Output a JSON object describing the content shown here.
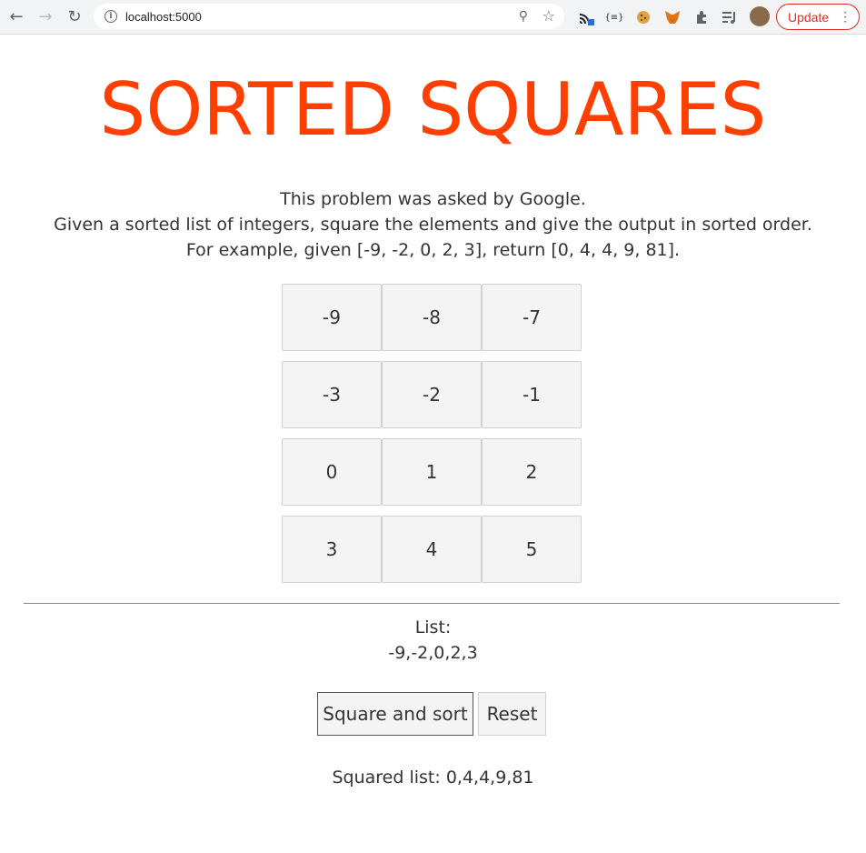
{
  "browser": {
    "url": "localhost:5000",
    "update_label": "Update"
  },
  "title": "SORTED SQUARES",
  "description": {
    "line1": "This problem was asked by Google.",
    "line2": "Given a sorted list of integers, square the elements and give the output in sorted order.",
    "line3": "For example, given [-9, -2, 0, 2, 3], return [0, 4, 4, 9, 81]."
  },
  "number_buttons": [
    "-9",
    "-8",
    "-7",
    "-3",
    "-2",
    "-1",
    "0",
    "1",
    "2",
    "3",
    "4",
    "5"
  ],
  "list": {
    "label": "List:",
    "value": "-9,-2,0,2,3"
  },
  "actions": {
    "square_sort_label": "Square and sort",
    "reset_label": "Reset"
  },
  "result": {
    "text": "Squared list: 0,4,4,9,81"
  },
  "colors": {
    "title": "#ff3f00",
    "update": "#d93025"
  }
}
